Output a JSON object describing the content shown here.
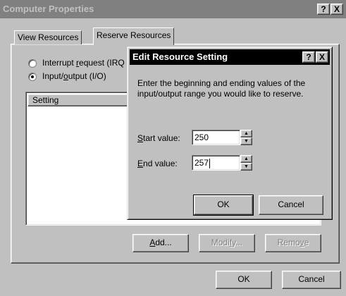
{
  "window": {
    "title": "Computer Properties",
    "help_btn": "?",
    "close_btn": "X"
  },
  "tabs": [
    {
      "label": "View Resources"
    },
    {
      "label": "Reserve Resources"
    }
  ],
  "radios": {
    "irq": {
      "pre": "Interrupt ",
      "u": "r",
      "post": "equest (IRQ"
    },
    "io": {
      "pre": "Input/",
      "u": "o",
      "post": "utput (I/O)"
    }
  },
  "list": {
    "header": "Setting"
  },
  "panel_buttons": {
    "add": {
      "u": "A",
      "post": "dd..."
    },
    "modify": {
      "pre": "Modi",
      "u": "f",
      "post": "y..."
    },
    "remove": {
      "pre": "Remo",
      "u": "v",
      "post": "e"
    }
  },
  "footer": {
    "ok": "OK",
    "cancel": "Cancel"
  },
  "dialog": {
    "title": "Edit Resource Setting",
    "help_btn": "?",
    "close_btn": "X",
    "description": "Enter the beginning and ending values of the input/output range you would like to reserve.",
    "start": {
      "u": "S",
      "post": "tart value:",
      "value": "250"
    },
    "end": {
      "u": "E",
      "post": "nd value:",
      "value": "257"
    },
    "spin_up": "▲",
    "spin_down": "▼",
    "ok": "OK",
    "cancel": "Cancel"
  }
}
